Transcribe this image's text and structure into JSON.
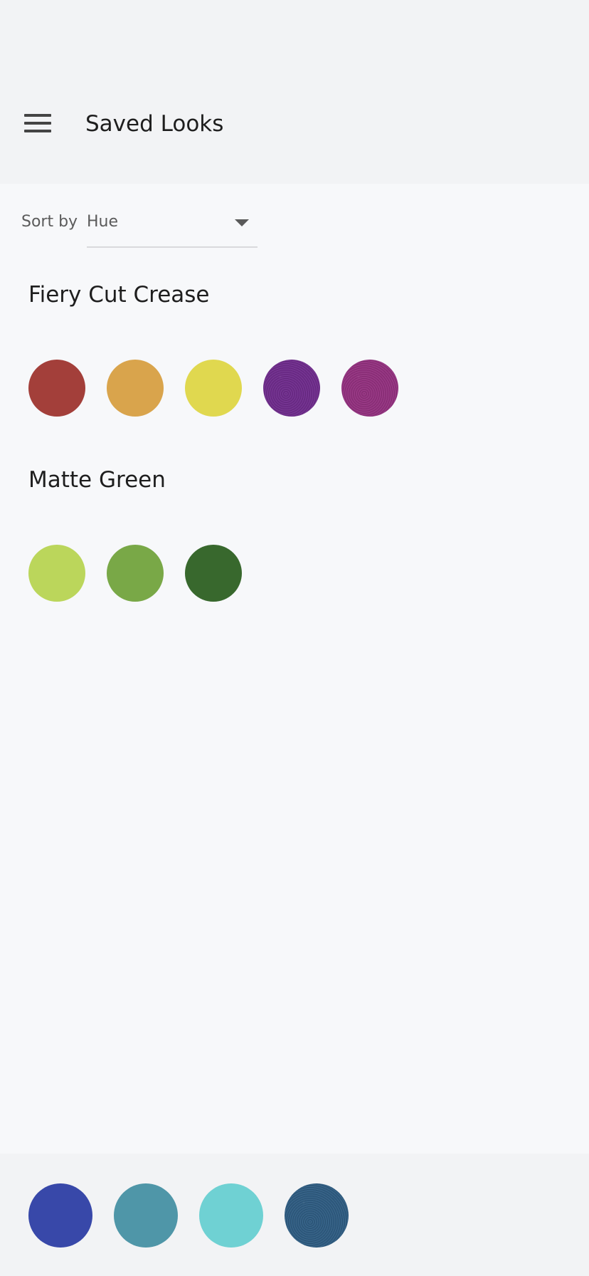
{
  "header": {
    "title": "Saved Looks",
    "menu_icon": "hamburger-menu-icon"
  },
  "sort": {
    "label": "Sort by",
    "selected": "Hue",
    "dropdown_icon": "caret-down-icon"
  },
  "looks": [
    {
      "title": "Fiery Cut Crease",
      "swatches": [
        {
          "color": "#a33f3a",
          "finish": "matte"
        },
        {
          "color": "#d9a44c",
          "finish": "matte"
        },
        {
          "color": "#e0d84f",
          "finish": "matte"
        },
        {
          "color": "#6f2c8c",
          "finish": "shimmer"
        },
        {
          "color": "#93317f",
          "finish": "shimmer"
        }
      ]
    },
    {
      "title": "Matte Green",
      "swatches": [
        {
          "color": "#bbd65b",
          "finish": "matte"
        },
        {
          "color": "#79a847",
          "finish": "matte"
        },
        {
          "color": "#38682d",
          "finish": "matte"
        }
      ]
    }
  ],
  "tray": {
    "swatches": [
      {
        "color": "#3848a9",
        "finish": "matte"
      },
      {
        "color": "#4f96a8",
        "finish": "matte"
      },
      {
        "color": "#6fd1d3",
        "finish": "matte"
      },
      {
        "color": "#2f5c82",
        "finish": "shimmer"
      }
    ]
  }
}
